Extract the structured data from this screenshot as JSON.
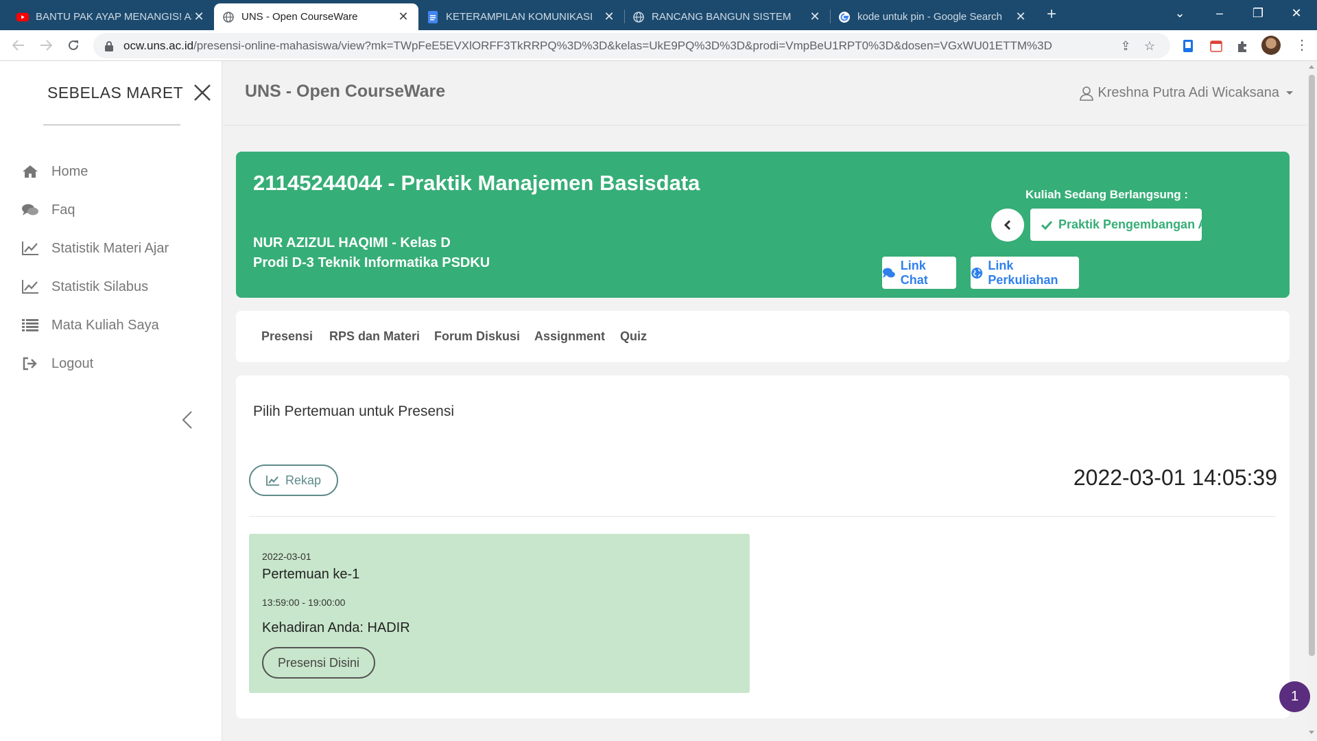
{
  "browser": {
    "tabs": [
      {
        "title": "BANTU PAK AYAP MENANGIS! AS",
        "favicon": "youtube-icon",
        "active": false
      },
      {
        "title": "UNS - Open CourseWare",
        "favicon": "globe-icon",
        "active": true
      },
      {
        "title": "KETERAMPILAN KOMUNIKASI",
        "favicon": "docs-icon",
        "active": false
      },
      {
        "title": "RANCANG BANGUN SISTEM",
        "favicon": "globe-icon",
        "active": false
      },
      {
        "title": "kode untuk pin - Google Search",
        "favicon": "google-icon",
        "active": false
      }
    ],
    "url_host": "ocw.uns.ac.id",
    "url_path": "/presensi-online-mahasiswa/view?mk=TWpFeE5EVXlORFF3TkRRPQ%3D%3D&kelas=UkE9PQ%3D%3D&prodi=VmpBeU1RPT0%3D&dosen=VGxWU01ETTM%3D"
  },
  "sidebar": {
    "brand": "SEBELAS MARET",
    "items": [
      {
        "label": "Home",
        "icon": "home-icon"
      },
      {
        "label": "Faq",
        "icon": "comments-icon"
      },
      {
        "label": "Statistik Materi Ajar",
        "icon": "line-chart-icon"
      },
      {
        "label": "Statistik Silabus",
        "icon": "line-chart-icon"
      },
      {
        "label": "Mata Kuliah Saya",
        "icon": "list-icon"
      },
      {
        "label": "Logout",
        "icon": "sign-out-icon"
      }
    ]
  },
  "header": {
    "app_title": "UNS - Open CourseWare",
    "user_name": "Kreshna Putra Adi Wicaksana"
  },
  "course": {
    "title": "21145244044 - Praktik Manajemen Basisdata",
    "lecturer_line": "NUR AZIZUL HAQIMI - Kelas D",
    "prodi_line": "Prodi D-3 Teknik Informatika PSDKU",
    "now_label": "Kuliah Sedang Berlangsung :",
    "now_course": "Praktik Pengembangan Aplikasi",
    "link_chat": "Link Chat",
    "link_lecture": "Link Perkuliahan"
  },
  "course_tabs": [
    "Presensi",
    "RPS dan Materi",
    "Forum Diskusi",
    "Assignment",
    "Quiz"
  ],
  "presensi": {
    "heading": "Pilih Pertemuan untuk Presensi",
    "rekap_label": "Rekap",
    "clock": "2022-03-01 14:05:39",
    "meeting": {
      "date": "2022-03-01",
      "title": "Pertemuan ke-1",
      "time": "13:59:00 - 19:00:00",
      "status": "Kehadiran Anda: HADIR",
      "button": "Presensi Disini"
    }
  },
  "floating_badge": "1",
  "colors": {
    "tabstrip": "#1c4a6e",
    "hero_green": "#36ae77",
    "meeting_bg": "#c8e6cb",
    "link_blue": "#2f80ed",
    "badge_purple": "#5b2d7e"
  }
}
